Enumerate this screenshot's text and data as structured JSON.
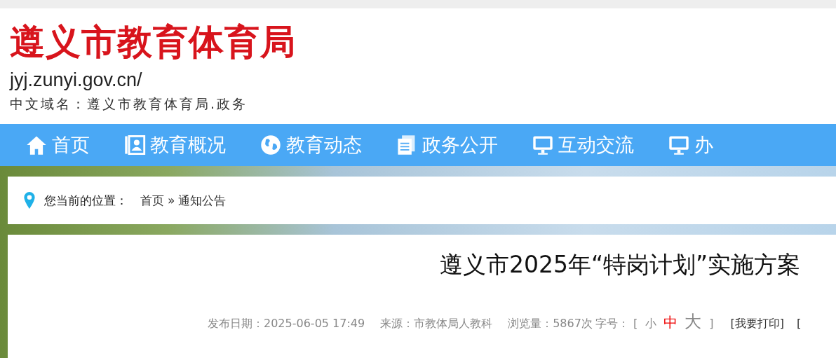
{
  "header": {
    "logo_text": "遵义市教育体育局",
    "domain": "jyj.zunyi.gov.cn/",
    "chinese_domain": "中文域名：遵义市教育体育局.政务"
  },
  "nav": [
    {
      "label": "首页",
      "kind": "house"
    },
    {
      "label": "教育概况",
      "kind": "card"
    },
    {
      "label": "教育动态",
      "kind": "globe"
    },
    {
      "label": "政务公开",
      "kind": "document"
    },
    {
      "label": "互动交流",
      "kind": "monitor"
    },
    {
      "label": "办",
      "kind": "monitor"
    }
  ],
  "breadcrumb": {
    "label": "您当前的位置：",
    "path": [
      "首页",
      "通知公告"
    ],
    "separator": "»"
  },
  "article": {
    "title": "遵义市2025年“特岗计划”实施方案",
    "published": "发布日期：2025-06-05 17:49",
    "source": "来源：市教体局人教科",
    "views": "浏览量：5867次",
    "font_size_label": "字号：",
    "bracket_open": "[",
    "bracket_close": "]",
    "font_sizes": [
      {
        "label": "小",
        "kind": "small",
        "selected": false
      },
      {
        "label": "中",
        "kind": "medium",
        "selected": true
      },
      {
        "label": "大",
        "kind": "large",
        "selected": false
      }
    ],
    "links": [
      "[我要打印]",
      "["
    ]
  }
}
